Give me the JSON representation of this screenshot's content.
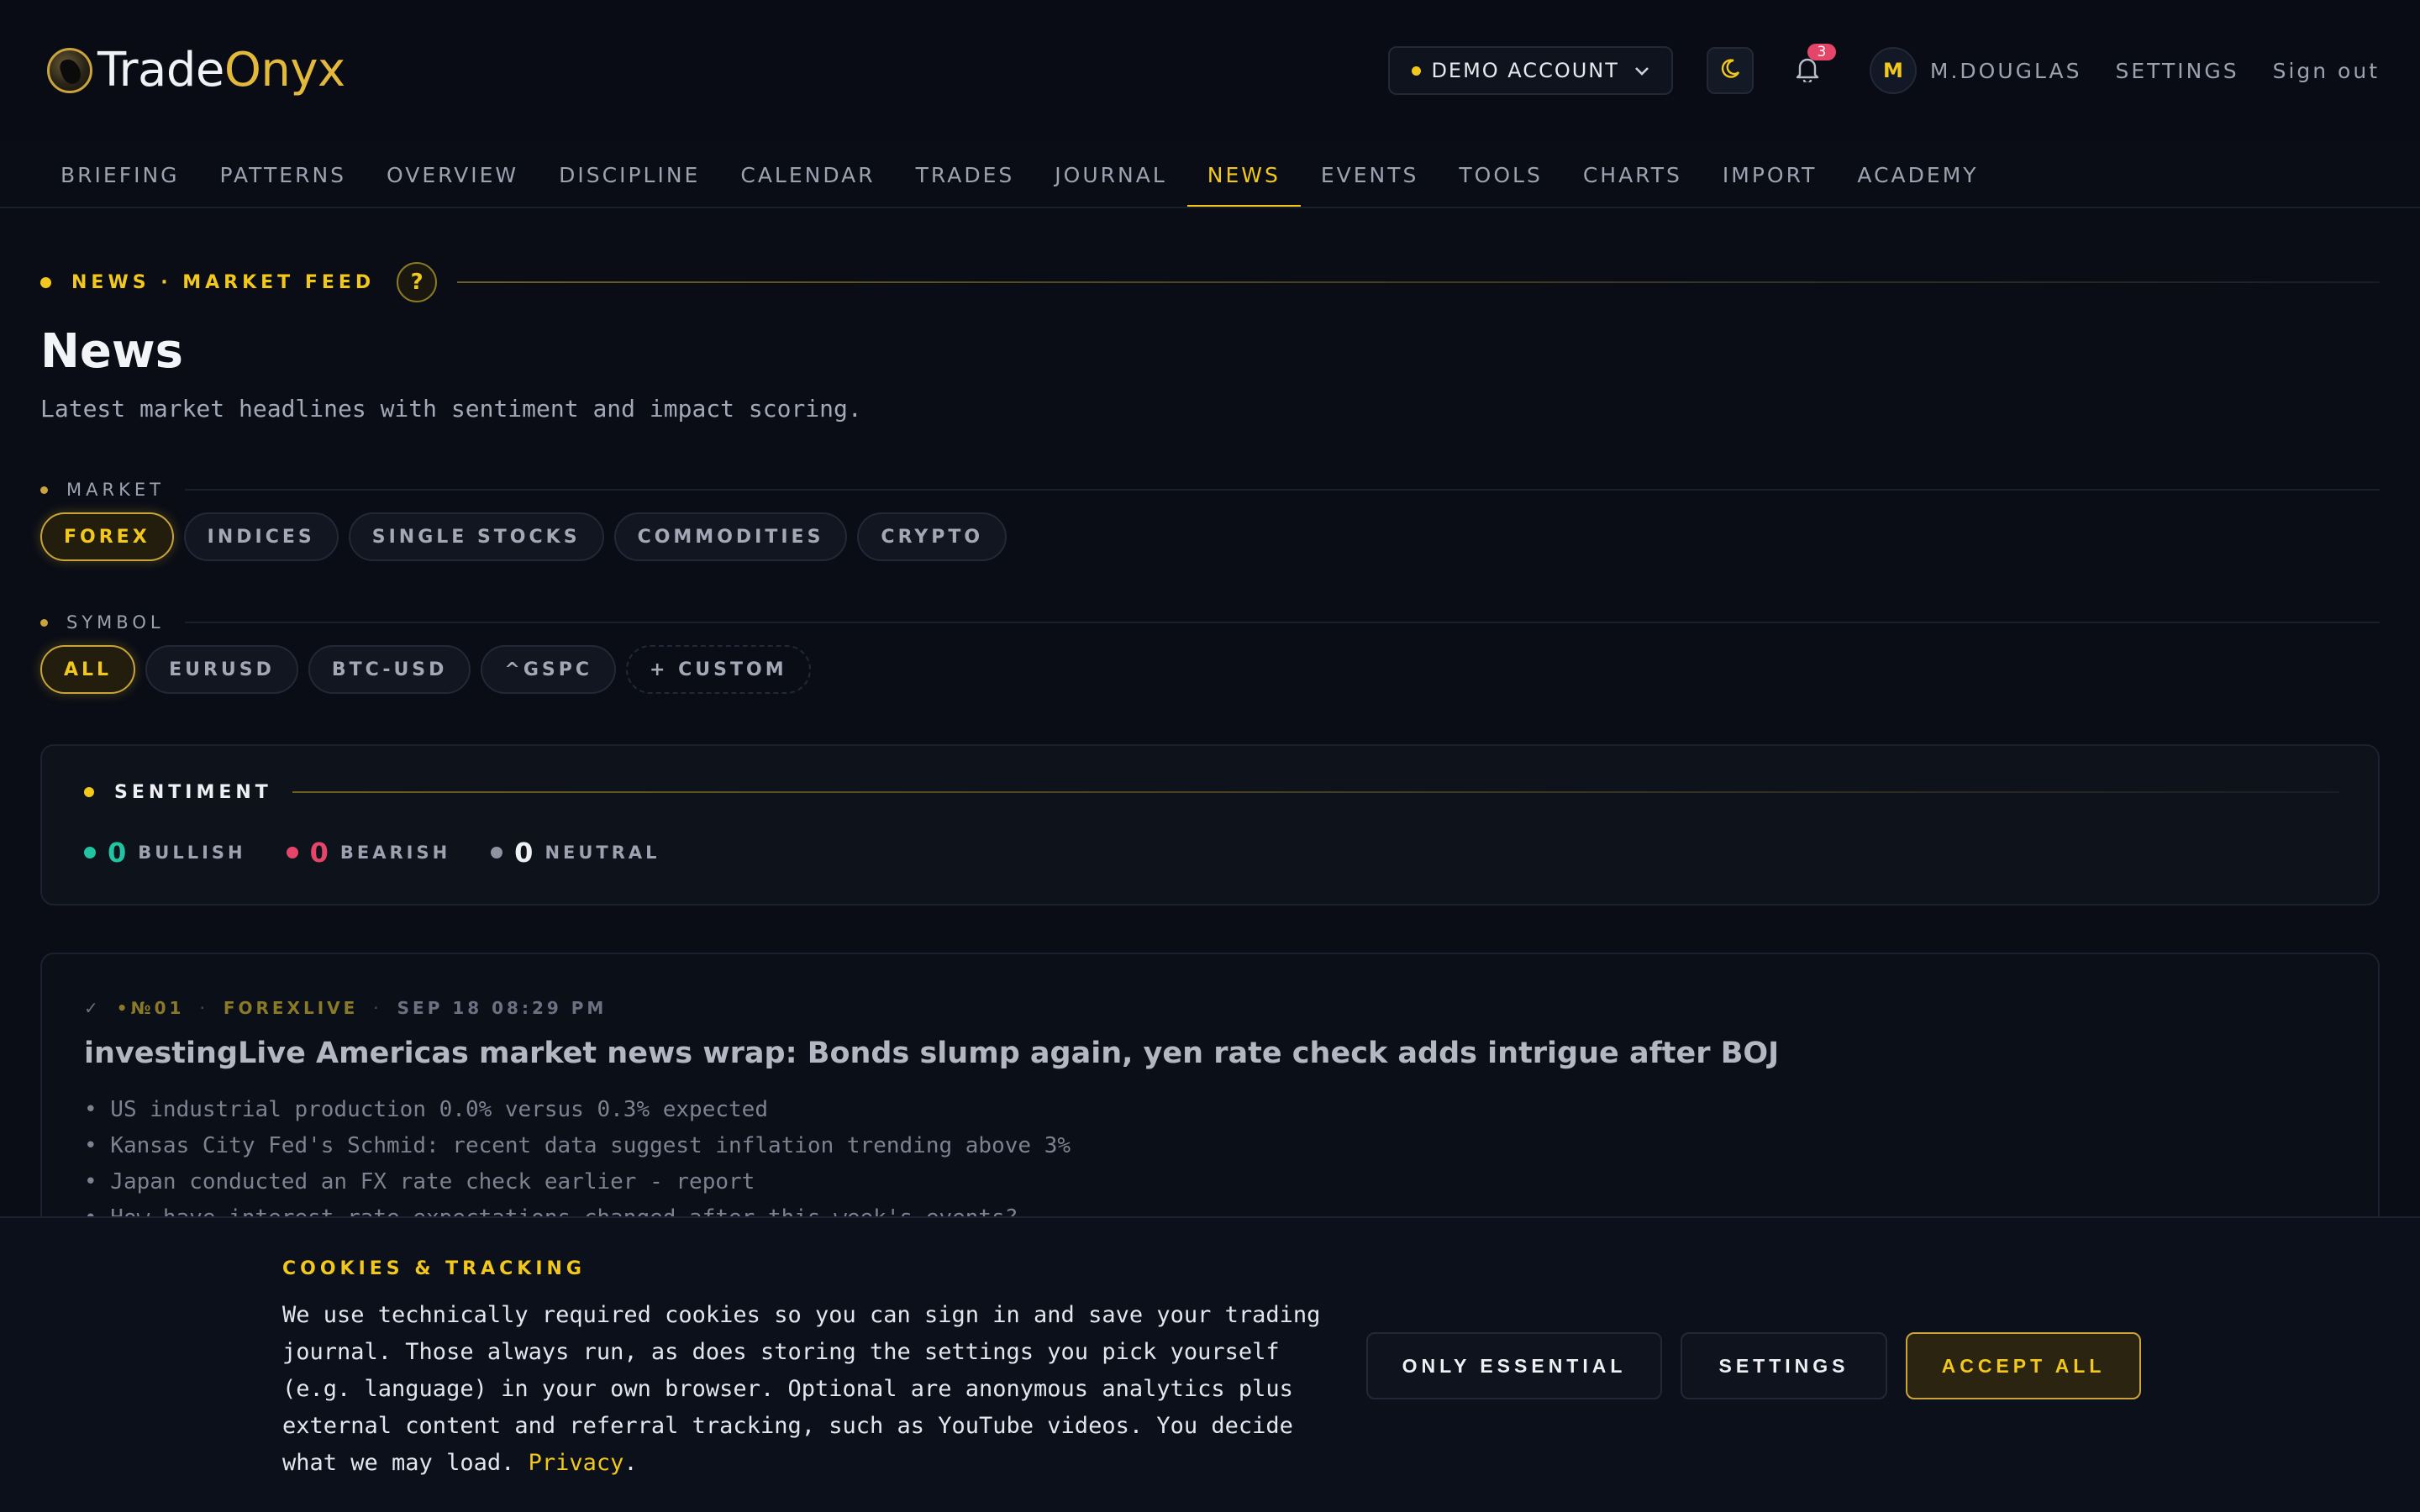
{
  "brand": {
    "name_a": "Trade",
    "name_b": "Onyx"
  },
  "header": {
    "account_label": "DEMO ACCOUNT",
    "notifications_count": "3",
    "avatar_initial": "M",
    "user_name": "M.DOUGLAS",
    "settings_label": "SETTINGS",
    "signout_label": "Sign out"
  },
  "nav": {
    "items": [
      "BRIEFING",
      "PATTERNS",
      "OVERVIEW",
      "DISCIPLINE",
      "CALENDAR",
      "TRADES",
      "JOURNAL",
      "NEWS",
      "EVENTS",
      "TOOLS",
      "CHARTS",
      "IMPORT",
      "ACADEMY"
    ],
    "active": "NEWS"
  },
  "page": {
    "eyebrow": "NEWS · MARKET FEED",
    "help": "?",
    "title": "News",
    "subtitle": "Latest market headlines with sentiment and impact scoring."
  },
  "filters": {
    "market_label": "MARKET",
    "markets": [
      "FOREX",
      "INDICES",
      "SINGLE STOCKS",
      "COMMODITIES",
      "CRYPTO"
    ],
    "market_active": "FOREX",
    "symbol_label": "SYMBOL",
    "symbols": [
      "ALL",
      "EURUSD",
      "BTC-USD",
      "^GSPC"
    ],
    "symbol_active": "ALL",
    "custom_label": "+ CUSTOM"
  },
  "sentiment": {
    "label": "SENTIMENT",
    "bullish": {
      "count": "0",
      "label": "BULLISH",
      "color": "#22c3a0"
    },
    "bearish": {
      "count": "0",
      "label": "BEARISH",
      "color": "#e6456a"
    },
    "neutral": {
      "count": "0",
      "label": "NEUTRAL",
      "color": "#8e93a0"
    }
  },
  "news": [
    {
      "check": "✓",
      "number": "•№01",
      "source": "FOREXLIVE",
      "date": "SEP 18 08:29 PM",
      "title": "investingLive Americas market news wrap: Bonds slump again, yen rate check adds intrigue after BOJ",
      "bullets": [
        "• US industrial production 0.0% versus 0.3% expected",
        "• Kansas City Fed's Schmid: recent data suggest inflation trending above 3%",
        "• Japan conducted an FX rate check earlier - report",
        "• How have interest rate expectations changed after this week's events?"
      ]
    }
  ],
  "cookie": {
    "title": "COOKIES & TRACKING",
    "body": "We use technically required cookies so you can sign in and save your trading journal. Those always run, as does storing the settings you pick yourself (e.g. language) in your own browser. Optional are anonymous analytics plus external content and referral tracking, such as YouTube videos. You decide what we may load. ",
    "privacy_link": "Privacy",
    "period": ".",
    "btn_essential": "ONLY ESSENTIAL",
    "btn_settings": "SETTINGS",
    "btn_accept": "ACCEPT ALL"
  },
  "colors": {
    "accent": "#f2c81c",
    "background": "#0a0d16"
  }
}
